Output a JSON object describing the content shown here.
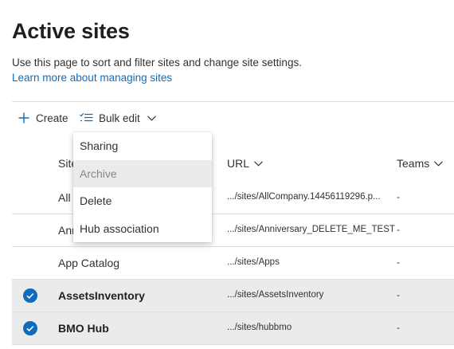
{
  "page": {
    "title": "Active sites",
    "description": "Use this page to sort and filter sites and change site settings.",
    "learn_more": "Learn more about managing sites"
  },
  "toolbar": {
    "create_label": "Create",
    "bulk_edit_label": "Bulk edit"
  },
  "bulk_menu": {
    "items": [
      "Sharing",
      "Archive",
      "Delete",
      "Hub association"
    ],
    "highlighted": "Archive"
  },
  "table": {
    "columns": {
      "site": "Site",
      "url": "URL",
      "teams": "Teams"
    },
    "rows": [
      {
        "name": "All",
        "url": ".../sites/AllCompany.14456119296.p...",
        "teams": "-",
        "selected": false
      },
      {
        "name": "Ann",
        "url": ".../sites/Anniversary_DELETE_ME_TEST",
        "teams": "-",
        "selected": false
      },
      {
        "name": "App Catalog",
        "url": ".../sites/Apps",
        "teams": "-",
        "selected": false
      },
      {
        "name": "AssetsInventory",
        "url": ".../sites/AssetsInventory",
        "teams": "-",
        "selected": true
      },
      {
        "name": "BMO Hub",
        "url": ".../sites/hubbmo",
        "teams": "-",
        "selected": true
      }
    ]
  },
  "colors": {
    "accent": "#0f6cbd",
    "selected_row": "#ebebeb",
    "divider": "#e1dfdd"
  }
}
